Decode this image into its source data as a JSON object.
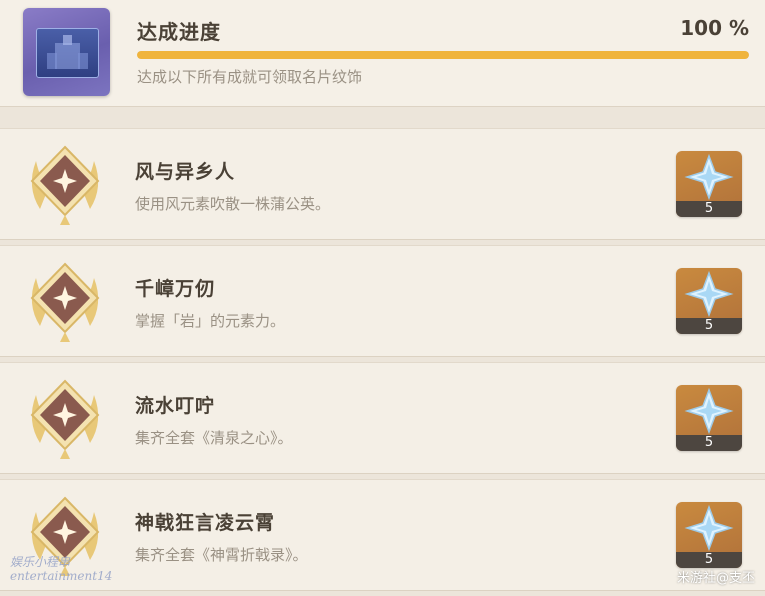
{
  "progress": {
    "title": "达成进度",
    "percent_text": "100 %",
    "value": 1.0,
    "description": "达成以下所有成就可领取名片纹饰"
  },
  "achievements": [
    {
      "title": "风与异乡人",
      "description": "使用风元素吹散一株蒲公英。",
      "reward_icon": "primogem-icon",
      "reward_count": "5"
    },
    {
      "title": "千嶂万仞",
      "description": "掌握「岩」的元素力。",
      "reward_icon": "primogem-icon",
      "reward_count": "5"
    },
    {
      "title": "流水叮咛",
      "description": "集齐全套《清泉之心》。",
      "reward_icon": "primogem-icon",
      "reward_count": "5"
    },
    {
      "title": "神戟狂言凌云霄",
      "description": "集齐全套《神霄折戟录》。",
      "reward_icon": "primogem-icon",
      "reward_count": "5"
    }
  ],
  "watermarks": {
    "left_line1": "娱乐小程串",
    "left_line2": "entertainment14",
    "right": "米游社@支丕"
  },
  "colors": {
    "progress_fill": "#f0b43c",
    "reward_bg": "#b0713a",
    "title_text": "#4a4136",
    "desc_text": "#9a9184"
  }
}
